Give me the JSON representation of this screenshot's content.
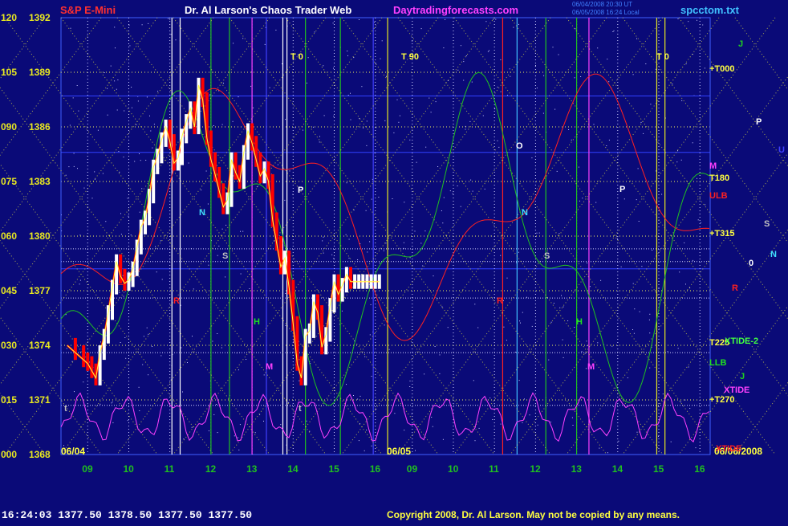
{
  "header": {
    "symbol": "S&P E-Mini",
    "title": "Dr. Al Larson's Chaos Trader Web",
    "site": "Daytradingforecasts.com",
    "filename": "spcctom.txt",
    "timestamp_line1": "06/04/2008 20:30 UT",
    "timestamp_line2": "06/05/2008 16:24 Local"
  },
  "footer": {
    "quote": "16:24:03  1377.50 1378.50 1377.50 1377.50",
    "copyright": "Copyright 2008, Dr. Al Larson. May not be copied by any means."
  },
  "colors": {
    "background": "#0a0a78",
    "price_up": "#ffffff",
    "price_down": "#ff0000",
    "grid_yellow": "#e8e820",
    "grid_green": "#20c020",
    "dotted_yellow": "#f0f060",
    "dotted_white": "#d0d0ff",
    "header_red": "#ff3030",
    "header_white": "#ffffff",
    "header_magenta": "#ff40ff",
    "header_cyan": "#40c0ff"
  },
  "chart_data": {
    "type": "line",
    "title": "S&P E-Mini",
    "y_left_labels": [
      "120",
      "105",
      "090",
      "075",
      "060",
      "045",
      "030",
      "015",
      "000"
    ],
    "y_right_labels": [
      "1392",
      "1389",
      "1386",
      "1383",
      "1380",
      "1377",
      "1374",
      "1371",
      "1368"
    ],
    "ylim": [
      1368,
      1392
    ],
    "x_tick_labels": [
      "09",
      "10",
      "11",
      "12",
      "13",
      "14",
      "15",
      "16",
      "09",
      "10",
      "11",
      "12",
      "13",
      "14",
      "15",
      "16"
    ],
    "date_labels": [
      "06/04",
      "06/05",
      "06/06/2008"
    ],
    "price_series": {
      "name": "S&P E-Mini",
      "x_hours": [
        8.5,
        8.7,
        8.9,
        9.0,
        9.1,
        9.2,
        9.3,
        9.4,
        9.5,
        9.6,
        9.7,
        9.8,
        9.9,
        10.0,
        10.1,
        10.2,
        10.3,
        10.4,
        10.5,
        10.6,
        10.7,
        10.8,
        10.9,
        11.0,
        11.1,
        11.2,
        11.3,
        11.4,
        11.5,
        11.6,
        11.7,
        11.8,
        11.9,
        12.0,
        12.1,
        12.2,
        12.3,
        12.4,
        12.5,
        12.6,
        12.7,
        12.8,
        12.9,
        13.0,
        13.1,
        13.2,
        13.3,
        13.4,
        13.5,
        13.6,
        13.7,
        13.8,
        13.9,
        14.0,
        14.1,
        14.2,
        14.3,
        14.4,
        14.5,
        14.6,
        14.7,
        14.8,
        14.9,
        15.0,
        15.1,
        15.2,
        15.3,
        15.4,
        15.5,
        15.6,
        15.7,
        15.8,
        15.9,
        16.0,
        16.1
      ],
      "close": [
        1374.0,
        1373.6,
        1373.2,
        1373.0,
        1372.6,
        1372.2,
        1373.6,
        1374.5,
        1375.8,
        1377.2,
        1378.6,
        1377.8,
        1377.4,
        1377.6,
        1378.2,
        1379.4,
        1380.5,
        1381.0,
        1382.2,
        1383.8,
        1384.4,
        1385.3,
        1386.0,
        1385.2,
        1384.0,
        1384.3,
        1385.5,
        1386.3,
        1387.0,
        1386.0,
        1388.3,
        1387.5,
        1385.4,
        1384.2,
        1383.4,
        1382.5,
        1381.6,
        1382.0,
        1384.2,
        1383.5,
        1383.0,
        1384.6,
        1385.8,
        1385.1,
        1384.2,
        1383.3,
        1383.7,
        1383.0,
        1380.9,
        1379.6,
        1378.3,
        1378.8,
        1377.2,
        1375.2,
        1373.0,
        1372.2,
        1374.5,
        1374.8,
        1376.4,
        1375.8,
        1373.9,
        1374.6,
        1376.2,
        1377.5,
        1376.8,
        1377.3,
        1377.9,
        1377.5,
        1377.5,
        1377.5,
        1377.5,
        1377.5,
        1377.5,
        1377.5,
        1377.5
      ]
    },
    "right_labels": [
      {
        "text": "J",
        "color": "#20d020"
      },
      {
        "text": "+T000",
        "color": "#ffff40"
      },
      {
        "text": "P",
        "color": "#ffffff"
      },
      {
        "text": "U",
        "color": "#4040ff"
      },
      {
        "text": "M",
        "color": "#ff40ff"
      },
      {
        "text": "T180",
        "color": "#ffff40"
      },
      {
        "text": "ULB",
        "color": "#ff2020"
      },
      {
        "text": "S",
        "color": "#c0c0c0"
      },
      {
        "text": "+T315",
        "color": "#ffff40"
      },
      {
        "text": "N",
        "color": "#40e0ff"
      },
      {
        "text": "0",
        "color": "#ffffff"
      },
      {
        "text": "R",
        "color": "#ff2020"
      },
      {
        "text": "T225",
        "color": "#ffff40"
      },
      {
        "text": "XTIDE-2",
        "color": "#40ff40"
      },
      {
        "text": "LLB",
        "color": "#20e020"
      },
      {
        "text": "J",
        "color": "#20d020"
      },
      {
        "text": "XTIDE",
        "color": "#ff40ff"
      },
      {
        "text": "+T270",
        "color": "#ffff40"
      },
      {
        "text": "XTIDE",
        "color": "#ff2020"
      }
    ],
    "chart_markers": [
      "T 0",
      "T 90",
      "T 0",
      "N",
      "N",
      "S",
      "S",
      "O",
      "P",
      "M",
      "M",
      "H",
      "H",
      "R",
      "R",
      "P",
      "t",
      "t"
    ]
  }
}
